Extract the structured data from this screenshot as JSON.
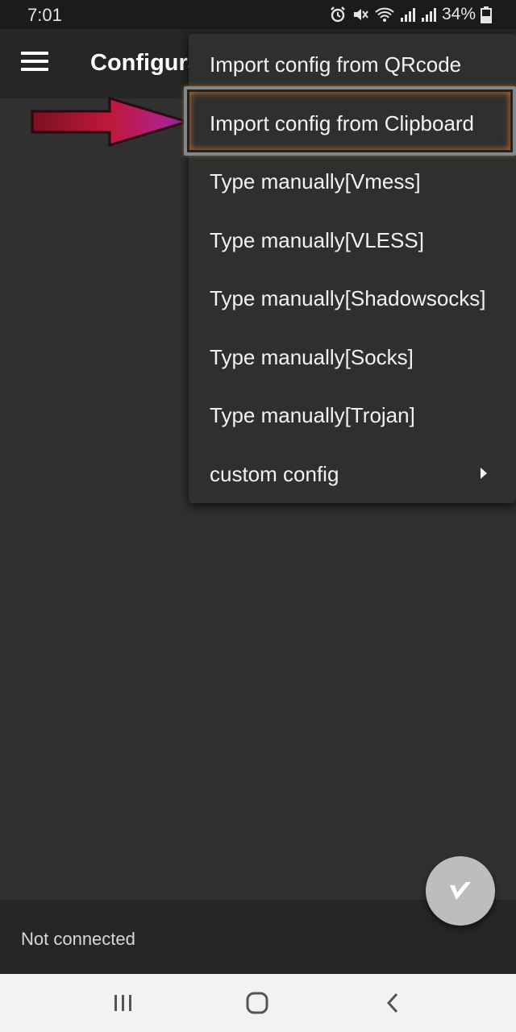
{
  "status_bar": {
    "time": "7:01",
    "battery": "34%",
    "icons": [
      "alarm-icon",
      "mute-icon",
      "wifi-icon",
      "signal-icon",
      "signal-icon",
      "battery-icon"
    ]
  },
  "app_bar": {
    "title": "Configura",
    "menu_icon": "hamburger-menu-icon"
  },
  "dropdown": {
    "items": [
      {
        "label": "Import config from QRcode"
      },
      {
        "label": "Import config from Clipboard",
        "highlighted": true
      },
      {
        "label": "Type manually[Vmess]"
      },
      {
        "label": "Type manually[VLESS]"
      },
      {
        "label": "Type manually[Shadowsocks]"
      },
      {
        "label": "Type manually[Socks]"
      },
      {
        "label": "Type manually[Trojan]"
      },
      {
        "label": "custom config",
        "submenu": true
      }
    ]
  },
  "annotation": {
    "arrow_color": "#b0203a",
    "highlight_color": "#b56a2f"
  },
  "footer": {
    "status": "Not connected"
  },
  "fab": {
    "icon": "v-logo-icon"
  },
  "nav_bar": {
    "buttons": [
      "recent-apps-icon",
      "home-icon",
      "back-icon"
    ]
  }
}
